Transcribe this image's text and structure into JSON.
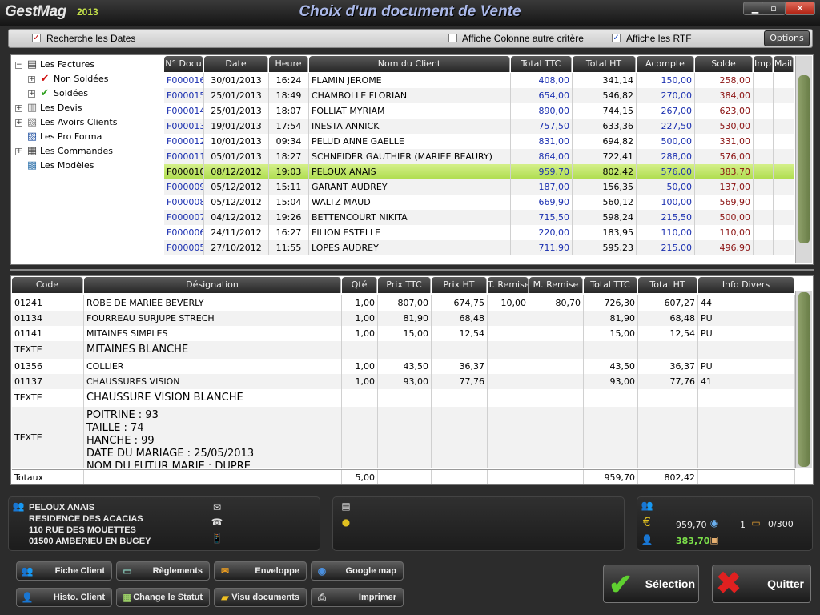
{
  "app": {
    "logo_main": "GestMag",
    "logo_year": "2013",
    "window_title": "Choix d'un document de Vente",
    "window_buttons": {
      "minimize": "▁",
      "restore": "▫",
      "close": "✕"
    }
  },
  "options_bar": {
    "recherche_dates": {
      "label": "Recherche les Dates",
      "checked": true
    },
    "autre_critere": {
      "label": "Affiche Colonne autre critère",
      "checked": false
    },
    "affiche_rtf": {
      "label": "Affiche les RTF",
      "checked": true
    },
    "options_button": "Options"
  },
  "tree": {
    "items": [
      {
        "label": "Les Factures",
        "expander": "−",
        "icon": "invoice-icon"
      },
      {
        "label": "Non Soldées",
        "expander": "+",
        "icon": "red-check-icon"
      },
      {
        "label": "Soldées",
        "expander": "+",
        "icon": "green-check-icon"
      },
      {
        "label": "Les Devis",
        "expander": "+",
        "icon": "quote-icon"
      },
      {
        "label": "Les Avoirs Clients",
        "expander": "+",
        "icon": "credit-icon"
      },
      {
        "label": "Les Pro Forma",
        "expander": "",
        "icon": "proforma-icon"
      },
      {
        "label": "Les Commandes",
        "expander": "+",
        "icon": "order-icon"
      },
      {
        "label": "Les Modèles",
        "expander": "",
        "icon": "template-icon"
      }
    ]
  },
  "documents": {
    "columns": [
      "N° Docu",
      "Date",
      "Heure",
      "Nom du Client",
      "Total TTC",
      "Total HT",
      "Acompte",
      "Solde",
      "Imp",
      "Mail"
    ],
    "rows": [
      {
        "num": "F000016",
        "date": "30/01/2013",
        "heure": "16:24",
        "client": "FLAMIN JEROME",
        "ttc": "408,00",
        "ht": "341,14",
        "acompte": "150,00",
        "solde": "258,00"
      },
      {
        "num": "F000015",
        "date": "25/01/2013",
        "heure": "18:49",
        "client": "CHAMBOLLE FLORIAN",
        "ttc": "654,00",
        "ht": "546,82",
        "acompte": "270,00",
        "solde": "384,00"
      },
      {
        "num": "F000014",
        "date": "25/01/2013",
        "heure": "18:07",
        "client": "FOLLIAT MYRIAM",
        "ttc": "890,00",
        "ht": "744,15",
        "acompte": "267,00",
        "solde": "623,00"
      },
      {
        "num": "F000013",
        "date": "19/01/2013",
        "heure": "17:54",
        "client": "INESTA ANNICK",
        "ttc": "757,50",
        "ht": "633,36",
        "acompte": "227,50",
        "solde": "530,00"
      },
      {
        "num": "F000012",
        "date": "10/01/2013",
        "heure": "09:34",
        "client": "PELUD ANNE GAELLE",
        "ttc": "831,00",
        "ht": "694,82",
        "acompte": "500,00",
        "solde": "331,00"
      },
      {
        "num": "F000011",
        "date": "05/01/2013",
        "heure": "18:27",
        "client": "SCHNEIDER GAUTHIER (MARIEE BEAURY)",
        "ttc": "864,00",
        "ht": "722,41",
        "acompte": "288,00",
        "solde": "576,00"
      },
      {
        "num": "F000010",
        "date": "08/12/2012",
        "heure": "19:03",
        "client": "PELOUX ANAIS",
        "ttc": "959,70",
        "ht": "802,42",
        "acompte": "576,00",
        "solde": "383,70"
      },
      {
        "num": "F000009",
        "date": "05/12/2012",
        "heure": "15:11",
        "client": "GARANT AUDREY",
        "ttc": "187,00",
        "ht": "156,35",
        "acompte": "50,00",
        "solde": "137,00"
      },
      {
        "num": "F000008",
        "date": "05/12/2012",
        "heure": "15:04",
        "client": "WALTZ MAUD",
        "ttc": "669,90",
        "ht": "560,12",
        "acompte": "100,00",
        "solde": "569,90"
      },
      {
        "num": "F000007",
        "date": "04/12/2012",
        "heure": "19:26",
        "client": "BETTENCOURT NIKITA",
        "ttc": "715,50",
        "ht": "598,24",
        "acompte": "215,50",
        "solde": "500,00"
      },
      {
        "num": "F000006",
        "date": "24/11/2012",
        "heure": "16:27",
        "client": "FILION ESTELLE",
        "ttc": "220,00",
        "ht": "183,95",
        "acompte": "110,00",
        "solde": "110,00"
      },
      {
        "num": "F000005",
        "date": "27/10/2012",
        "heure": "11:55",
        "client": "LOPES AUDREY",
        "ttc": "711,90",
        "ht": "595,23",
        "acompte": "215,00",
        "solde": "496,90"
      }
    ],
    "selected_index": 6
  },
  "lines": {
    "columns": [
      "Code",
      "Désignation",
      "Qté",
      "Prix TTC",
      "Prix HT",
      "T. Remise",
      "M. Remise",
      "Total TTC",
      "Total HT",
      "Info Divers"
    ],
    "rows": [
      {
        "code": "01241",
        "designation": "ROBE DE MARIEE BEVERLY",
        "qte": "1,00",
        "prix_ttc": "807,00",
        "prix_ht": "674,75",
        "t_remise": "10,00",
        "m_remise": "80,70",
        "total_ttc": "726,30",
        "total_ht": "607,27",
        "info": "44",
        "type": "item"
      },
      {
        "code": "01134",
        "designation": "FOURREAU SURJUPE STRECH",
        "qte": "1,00",
        "prix_ttc": "81,90",
        "prix_ht": "68,48",
        "t_remise": "",
        "m_remise": "",
        "total_ttc": "81,90",
        "total_ht": "68,48",
        "info": "PU",
        "type": "item"
      },
      {
        "code": "01141",
        "designation": "MITAINES SIMPLES",
        "qte": "1,00",
        "prix_ttc": "15,00",
        "prix_ht": "12,54",
        "t_remise": "",
        "m_remise": "",
        "total_ttc": "15,00",
        "total_ht": "12,54",
        "info": "PU",
        "type": "item"
      },
      {
        "code": "TEXTE",
        "designation": "MITAINES BLANCHE",
        "type": "text"
      },
      {
        "code": "01356",
        "designation": "COLLIER",
        "qte": "1,00",
        "prix_ttc": "43,50",
        "prix_ht": "36,37",
        "t_remise": "",
        "m_remise": "",
        "total_ttc": "43,50",
        "total_ht": "36,37",
        "info": "PU",
        "type": "item"
      },
      {
        "code": "01137",
        "designation": "CHAUSSURES VISION",
        "qte": "1,00",
        "prix_ttc": "93,00",
        "prix_ht": "77,76",
        "t_remise": "",
        "m_remise": "",
        "total_ttc": "93,00",
        "total_ht": "77,76",
        "info": "41",
        "type": "item"
      },
      {
        "code": "TEXTE",
        "designation": "CHAUSSURE VISION BLANCHE",
        "type": "text"
      },
      {
        "code": "TEXTE",
        "designation_lines": [
          "POITRINE : 93",
          "TAILLE : 74",
          "HANCHE : 99",
          "DATE DU MARIAGE : 25/05/2013",
          "NOM DU FUTUR MARIE : DUPRE"
        ],
        "type": "multitext"
      }
    ],
    "totals": {
      "label": "Totaux",
      "qte": "5,00",
      "total_ttc": "959,70",
      "total_ht": "802,42"
    }
  },
  "client": {
    "name": "PELOUX ANAIS",
    "address1": "RESIDENCE DES ACACIAS",
    "address2": "110 RUE DES MOUETTES",
    "city": "01500  AMBERIEU EN BUGEY"
  },
  "summary": {
    "euro_amount": "959,70",
    "paid_amount": "383,70",
    "count": "1",
    "ratio": "0/300"
  },
  "buttons": {
    "fiche_client": "Fiche Client",
    "reglements": "Règlements",
    "enveloppe": "Enveloppe",
    "google_map": "Google map",
    "histo_client": "Histo. Client",
    "change_statut": "Change le Statut",
    "visu_documents": "Visu documents",
    "imprimer": "Imprimer",
    "selection": "Sélection",
    "quitter": "Quitter"
  },
  "colors": {
    "selected_row": "#b8e35a",
    "doc_number": "#1a2fb0",
    "solde": "#8a1010",
    "accent_green": "#9fd23a"
  }
}
